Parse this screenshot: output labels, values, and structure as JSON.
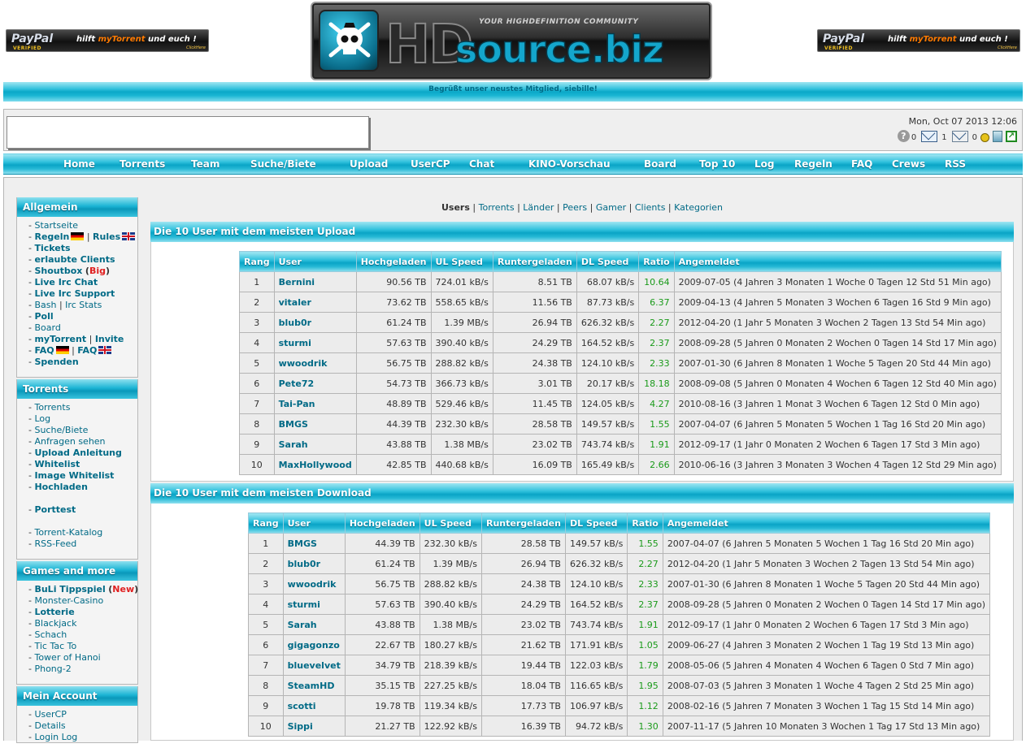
{
  "header": {
    "paypal_logo": "PayPal",
    "paypal_verified": "VERIFIED",
    "paypal_text_prefix": "hilft ",
    "paypal_text_brand": "myTorrent",
    "paypal_text_suffix": " und euch !",
    "paypal_click": "ClickHere",
    "logo_hd": "HD",
    "logo_source": "source.biz",
    "logo_tagline": "YOUR HIGHDEFINITION COMMUNITY",
    "welcome": "Begrüßt unser neustes Mitglied, siebille!"
  },
  "status": {
    "datetime": "Mon, Oct 07 2013 12:06",
    "help_count": "0",
    "mail_count": "1",
    "mail2_count": "0"
  },
  "nav": {
    "items": [
      "Home",
      "Torrents",
      "Team",
      "Suche/Biete",
      "Upload",
      "UserCP",
      "Chat",
      "KINO-Vorschau",
      "Board",
      "Top 10",
      "Log",
      "Regeln",
      "FAQ",
      "Crews",
      "RSS"
    ]
  },
  "sidebar": {
    "allgemein": {
      "title": "Allgemein",
      "startseite": "Startseite",
      "regeln": "Regeln",
      "rules": "Rules",
      "tickets": "Tickets",
      "clients": "erlaubte Clients",
      "shoutbox": "Shoutbox",
      "big": "Big",
      "irc_chat": "Live Irc Chat",
      "irc_support": "Live Irc Support",
      "bash": "Bash",
      "irc_stats": "Irc Stats",
      "poll": "Poll",
      "board": "Board",
      "mytorrent": "myTorrent",
      "invite": "Invite",
      "faq_de": "FAQ",
      "faq_en": "FAQ",
      "spenden": "Spenden"
    },
    "torrents": {
      "title": "Torrents",
      "items": [
        {
          "label": "Torrents",
          "bold": false
        },
        {
          "label": "Log",
          "bold": false
        },
        {
          "label": "Suche/Biete",
          "bold": false
        },
        {
          "label": "Anfragen sehen",
          "bold": false
        },
        {
          "label": "Upload Anleitung",
          "bold": true
        },
        {
          "label": "Whitelist",
          "bold": true
        },
        {
          "label": "Image Whitelist",
          "bold": true
        },
        {
          "label": "Hochladen",
          "bold": true
        },
        {
          "label": "",
          "bold": false
        },
        {
          "label": "Porttest",
          "bold": true
        },
        {
          "label": "",
          "bold": false
        },
        {
          "label": "Torrent-Katalog",
          "bold": false
        },
        {
          "label": "RSS-Feed",
          "bold": false
        }
      ]
    },
    "games": {
      "title": "Games and more",
      "buli": "BuLi Tippspiel",
      "new": "New",
      "items": [
        "Monster-Casino",
        "Lotterie",
        "Blackjack",
        "Schach",
        "Tic Tac To",
        "Tower of Hanoi",
        "Phong-2"
      ],
      "bold": [
        false,
        true,
        false,
        false,
        false,
        false,
        false
      ]
    },
    "account": {
      "title": "Mein Account",
      "items": [
        "UserCP",
        "Details",
        "Login Log"
      ]
    }
  },
  "subnav": {
    "current": "Users",
    "links": [
      "Torrents",
      "Länder",
      "Peers",
      "Gamer",
      "Clients",
      "Kategorien"
    ]
  },
  "upload_section": {
    "title": "Die 10 User mit dem meisten Upload",
    "columns": [
      "Rang",
      "User",
      "Hochgeladen",
      "UL Speed",
      "Runtergeladen",
      "DL Speed",
      "Ratio",
      "Angemeldet"
    ],
    "rows": [
      [
        "1",
        "Bernini",
        "90.56 TB",
        "724.01 kB/s",
        "8.51 TB",
        "68.07 kB/s",
        "10.64",
        "2009-07-05 (4 Jahren 3 Monaten 1 Woche 0 Tagen 12 Std 51 Min ago)"
      ],
      [
        "2",
        "vitaler",
        "73.62 TB",
        "558.65 kB/s",
        "11.56 TB",
        "87.73 kB/s",
        "6.37",
        "2009-04-13 (4 Jahren 5 Monaten 3 Wochen 6 Tagen 16 Std 9 Min ago)"
      ],
      [
        "3",
        "blub0r",
        "61.24 TB",
        "1.39 MB/s",
        "26.94 TB",
        "626.32 kB/s",
        "2.27",
        "2012-04-20 (1 Jahr 5 Monaten 3 Wochen 2 Tagen 13 Std 54 Min ago)"
      ],
      [
        "4",
        "sturmi",
        "57.63 TB",
        "390.40 kB/s",
        "24.29 TB",
        "164.52 kB/s",
        "2.37",
        "2008-09-28 (5 Jahren 0 Monaten 2 Wochen 0 Tagen 14 Std 17 Min ago)"
      ],
      [
        "5",
        "wwoodrik",
        "56.75 TB",
        "288.82 kB/s",
        "24.38 TB",
        "124.10 kB/s",
        "2.33",
        "2007-01-30 (6 Jahren 8 Monaten 1 Woche 5 Tagen 20 Std 44 Min ago)"
      ],
      [
        "6",
        "Pete72",
        "54.73 TB",
        "366.73 kB/s",
        "3.01 TB",
        "20.17 kB/s",
        "18.18",
        "2008-09-08 (5 Jahren 0 Monaten 4 Wochen 6 Tagen 12 Std 40 Min ago)"
      ],
      [
        "7",
        "Tai-Pan",
        "48.89 TB",
        "529.46 kB/s",
        "11.45 TB",
        "124.05 kB/s",
        "4.27",
        "2010-08-16 (3 Jahren 1 Monat 3 Wochen 6 Tagen 12 Std 0 Min ago)"
      ],
      [
        "8",
        "BMGS",
        "44.39 TB",
        "232.30 kB/s",
        "28.58 TB",
        "149.57 kB/s",
        "1.55",
        "2007-04-07 (6 Jahren 5 Monaten 5 Wochen 1 Tag 16 Std 20 Min ago)"
      ],
      [
        "9",
        "Sarah",
        "43.88 TB",
        "1.38 MB/s",
        "23.02 TB",
        "743.74 kB/s",
        "1.91",
        "2012-09-17 (1 Jahr 0 Monaten 2 Wochen 6 Tagen 17 Std 3 Min ago)"
      ],
      [
        "10",
        "MaxHollywood",
        "42.85 TB",
        "440.68 kB/s",
        "16.09 TB",
        "165.49 kB/s",
        "2.66",
        "2010-06-16 (3 Jahren 3 Monaten 3 Wochen 4 Tagen 12 Std 29 Min ago)"
      ]
    ]
  },
  "download_section": {
    "title": "Die 10 User mit dem meisten Download",
    "columns": [
      "Rang",
      "User",
      "Hochgeladen",
      "UL Speed",
      "Runtergeladen",
      "DL Speed",
      "Ratio",
      "Angemeldet"
    ],
    "rows": [
      [
        "1",
        "BMGS",
        "44.39 TB",
        "232.30 kB/s",
        "28.58 TB",
        "149.57 kB/s",
        "1.55",
        "2007-04-07 (6 Jahren 5 Monaten 5 Wochen 1 Tag 16 Std 20 Min ago)"
      ],
      [
        "2",
        "blub0r",
        "61.24 TB",
        "1.39 MB/s",
        "26.94 TB",
        "626.32 kB/s",
        "2.27",
        "2012-04-20 (1 Jahr 5 Monaten 3 Wochen 2 Tagen 13 Std 54 Min ago)"
      ],
      [
        "3",
        "wwoodrik",
        "56.75 TB",
        "288.82 kB/s",
        "24.38 TB",
        "124.10 kB/s",
        "2.33",
        "2007-01-30 (6 Jahren 8 Monaten 1 Woche 5 Tagen 20 Std 44 Min ago)"
      ],
      [
        "4",
        "sturmi",
        "57.63 TB",
        "390.40 kB/s",
        "24.29 TB",
        "164.52 kB/s",
        "2.37",
        "2008-09-28 (5 Jahren 0 Monaten 2 Wochen 0 Tagen 14 Std 17 Min ago)"
      ],
      [
        "5",
        "Sarah",
        "43.88 TB",
        "1.38 MB/s",
        "23.02 TB",
        "743.74 kB/s",
        "1.91",
        "2012-09-17 (1 Jahr 0 Monaten 2 Wochen 6 Tagen 17 Std 3 Min ago)"
      ],
      [
        "6",
        "gigagonzo",
        "22.67 TB",
        "180.27 kB/s",
        "21.62 TB",
        "171.91 kB/s",
        "1.05",
        "2009-06-27 (4 Jahren 3 Monaten 2 Wochen 1 Tag 19 Std 13 Min ago)"
      ],
      [
        "7",
        "bluevelvet",
        "34.79 TB",
        "218.39 kB/s",
        "19.44 TB",
        "122.03 kB/s",
        "1.79",
        "2008-05-06 (5 Jahren 4 Monaten 4 Wochen 6 Tagen 0 Std 7 Min ago)"
      ],
      [
        "8",
        "SteamHD",
        "35.15 TB",
        "227.25 kB/s",
        "18.04 TB",
        "116.65 kB/s",
        "1.95",
        "2008-07-03 (5 Jahren 3 Monaten 1 Woche 4 Tagen 2 Std 25 Min ago)"
      ],
      [
        "9",
        "scotti",
        "19.78 TB",
        "119.34 kB/s",
        "17.73 TB",
        "106.97 kB/s",
        "1.12",
        "2008-02-16 (5 Jahren 7 Monaten 3 Wochen 1 Tag 15 Std 14 Min ago)"
      ],
      [
        "10",
        "Sippi",
        "21.27 TB",
        "122.92 kB/s",
        "16.39 TB",
        "94.72 kB/s",
        "1.30",
        "2007-11-17 (5 Jahren 10 Monaten 3 Wochen 1 Tag 17 Std 13 Min ago)"
      ]
    ]
  },
  "colors": {
    "accent": "#0aa8c8",
    "link": "#006a86",
    "ratio": "#1a9a1a",
    "new": "#e02020"
  }
}
